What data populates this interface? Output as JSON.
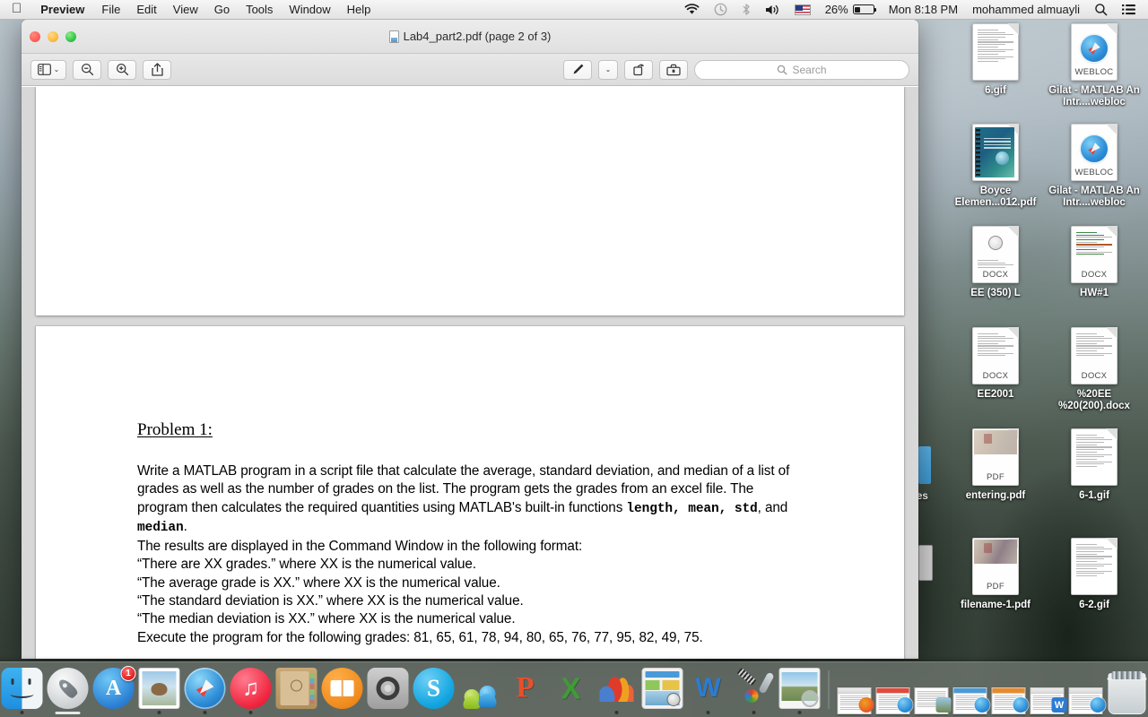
{
  "menubar": {
    "apple_icon": "apple-logo",
    "items": [
      {
        "label": "Preview",
        "bold": true
      },
      {
        "label": "File",
        "bold": false
      },
      {
        "label": "Edit",
        "bold": false
      },
      {
        "label": "View",
        "bold": false
      },
      {
        "label": "Go",
        "bold": false
      },
      {
        "label": "Tools",
        "bold": false
      },
      {
        "label": "Window",
        "bold": false
      },
      {
        "label": "Help",
        "bold": false
      }
    ],
    "status": {
      "wifi_icon": "wifi-icon",
      "timemachine_icon": "time-machine-icon",
      "bluetooth_icon": "bluetooth-icon",
      "volume_icon": "volume-icon",
      "input_flag_icon": "us-flag-icon",
      "battery_percent": "26%",
      "battery_icon": "battery-icon",
      "datetime": "Mon 8:18 PM",
      "username": "mohammed almuayli",
      "search_icon": "spotlight-search-icon",
      "notification_icon": "notification-center-icon"
    }
  },
  "window": {
    "title": "Lab4_part2.pdf (page 2 of 3)",
    "traffic_lights": {
      "close": "close-button",
      "minimize": "minimize-button",
      "zoom": "zoom-button"
    },
    "toolbar": {
      "sidebar_icon": "sidebar-toggle-icon",
      "sidebar_chevron": "⌄",
      "zoom_out_icon": "zoom-out-icon",
      "zoom_in_icon": "zoom-in-icon",
      "share_icon": "share-icon",
      "markup_icon": "markup-pen-icon",
      "markup_chevron": "⌄",
      "rotate_icon": "rotate-right-icon",
      "toolbox_icon": "toolbox-icon",
      "search_icon": "search-icon",
      "search_placeholder": "Search",
      "search_value": ""
    }
  },
  "document": {
    "heading": "Problem 1:",
    "paragraph_part1": "Write a MATLAB program in a script file that calculate the average, standard deviation, and median of a list of grades as well as the number of grades on the list. The program gets the grades from an excel file. The program then calculates the required quantities using MATLAB's built-in functions ",
    "functions_1": "length, mean, std",
    "paragraph_mid": ", and ",
    "functions_2": "median",
    "paragraph_end": ".",
    "lines": [
      "The results are displayed in the Command Window in the following format:",
      "“There are XX grades.” where XX is the numerical value.",
      "“The average grade is XX.” where XX is the numerical value.",
      "“The standard deviation is XX.” where XX is the numerical value.",
      "“The median deviation is XX.” where XX is the numerical value.",
      "Execute the program for the following grades: 81, 65, 61, 78, 94, 80, 65, 76, 77, 95, 82, 49, 75."
    ]
  },
  "desktop": {
    "icons": [
      {
        "label": "6.gif",
        "type": "gif"
      },
      {
        "label": "Gilat - MATLAB An Intr....webloc",
        "type": "webloc"
      },
      {
        "label": "Boyce Elemen...012.pdf",
        "type": "book-pdf"
      },
      {
        "label": "Gilat - MATLAB An Intr....webloc",
        "type": "webloc"
      },
      {
        "label": "EE (350) L",
        "type": "docx-seal"
      },
      {
        "label": "HW#1",
        "type": "docx-code"
      },
      {
        "label": "EE2001",
        "type": "docx"
      },
      {
        "label": "%20EE %20(200).docx",
        "type": "docx"
      },
      {
        "label": "entering.pdf",
        "type": "pdf-photo"
      },
      {
        "label": "6-1.gif",
        "type": "gif"
      },
      {
        "label": "filename-1.pdf",
        "type": "pdf-photo2"
      },
      {
        "label": "6-2.gif",
        "type": "gif"
      }
    ],
    "occluded_label": "es"
  },
  "dock": {
    "apps": [
      {
        "name": "Finder",
        "running": true
      },
      {
        "name": "Launchpad",
        "running": false
      },
      {
        "name": "App Store",
        "running": false,
        "badge": "1"
      },
      {
        "name": "Mail",
        "running": true
      },
      {
        "name": "Safari",
        "running": true
      },
      {
        "name": "iTunes",
        "running": true
      },
      {
        "name": "Contacts",
        "running": false
      },
      {
        "name": "iBooks",
        "running": false
      },
      {
        "name": "System Preferences",
        "running": false
      },
      {
        "name": "Skype",
        "running": false
      },
      {
        "name": "Messenger",
        "running": false
      },
      {
        "name": "PowerPoint",
        "running": false
      },
      {
        "name": "Excel",
        "running": false
      },
      {
        "name": "MATLAB",
        "running": true
      },
      {
        "name": "Dashboard",
        "running": false
      },
      {
        "name": "Word",
        "running": true
      },
      {
        "name": "Xcode",
        "running": true
      },
      {
        "name": "Preview",
        "running": true
      }
    ],
    "minimized": [
      {
        "name": "MATLAB window",
        "badge": "matlab"
      },
      {
        "name": "Safari window",
        "badge": "safari"
      },
      {
        "name": "Document window",
        "badge": "preview"
      },
      {
        "name": "Safari window",
        "badge": "safari"
      },
      {
        "name": "Safari window",
        "badge": "safari"
      },
      {
        "name": "Word document window",
        "badge": "word"
      },
      {
        "name": "Safari window",
        "badge": "safari"
      }
    ],
    "trash": "Trash"
  }
}
